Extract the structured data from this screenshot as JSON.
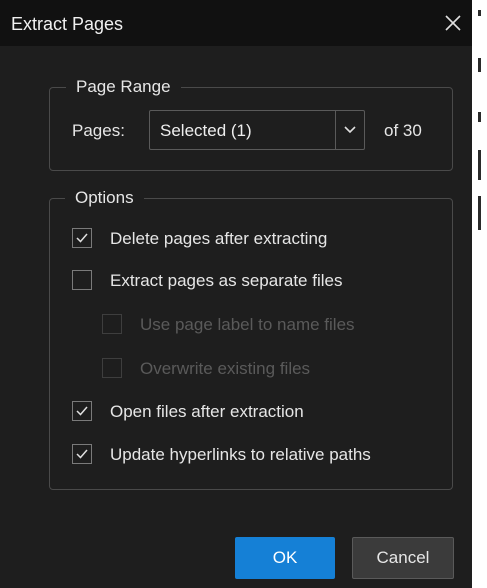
{
  "dialog": {
    "title": "Extract Pages",
    "close_icon": "close-icon"
  },
  "page_range": {
    "legend": "Page Range",
    "pages_label": "Pages:",
    "selected_value": "Selected (1)",
    "dropdown_icon": "chevron-down-icon",
    "of_total": "of 30"
  },
  "options": {
    "legend": "Options",
    "items": [
      {
        "label": "Delete pages after extracting",
        "checked": true,
        "enabled": true
      },
      {
        "label": "Extract pages as separate files",
        "checked": false,
        "enabled": true
      },
      {
        "label": "Use page label to name files",
        "checked": false,
        "enabled": false
      },
      {
        "label": "Overwrite existing files",
        "checked": false,
        "enabled": false
      },
      {
        "label": "Open files after extraction",
        "checked": true,
        "enabled": true
      },
      {
        "label": "Update hyperlinks to relative paths",
        "checked": true,
        "enabled": true
      }
    ]
  },
  "buttons": {
    "ok_label": "OK",
    "cancel_label": "Cancel"
  },
  "colors": {
    "dialog_bg": "#1e1e1e",
    "titlebar_bg": "#111111",
    "accent": "#1580d6",
    "text": "#e6e6e6",
    "disabled_text": "#5a5a5a"
  }
}
